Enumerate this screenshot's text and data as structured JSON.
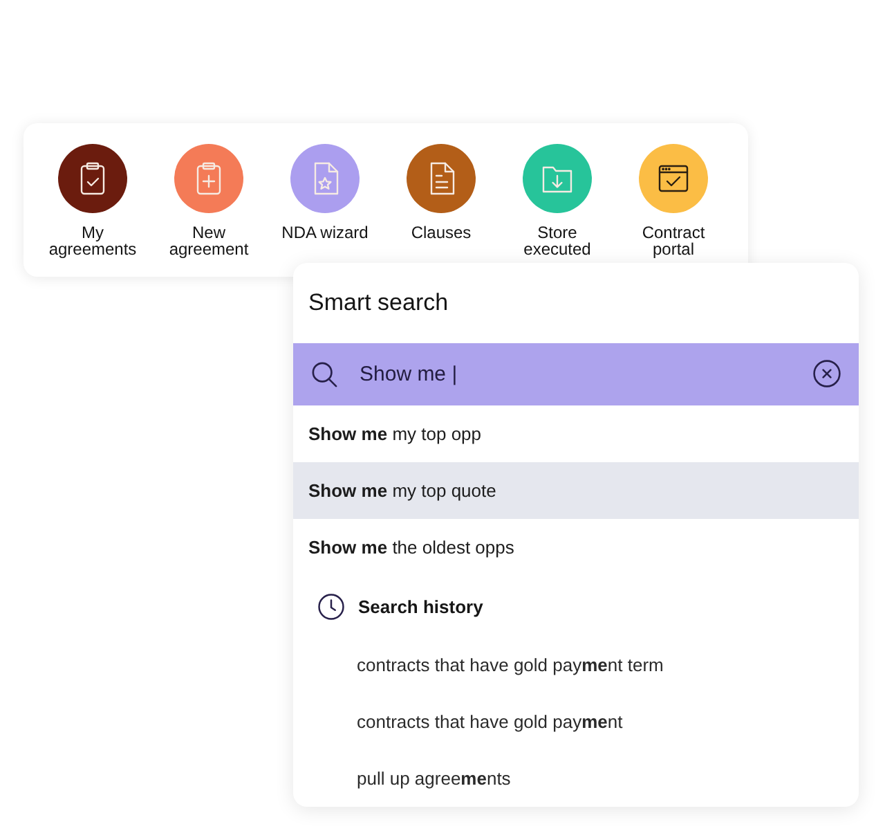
{
  "shortcuts": [
    {
      "label": "My agreements",
      "color": "#6b1c0e"
    },
    {
      "label": "New agreement",
      "color": "#f47b57"
    },
    {
      "label": "NDA wizard",
      "color": "#ab9eef"
    },
    {
      "label": "Clauses",
      "color": "#b35e18"
    },
    {
      "label": "Store executed",
      "color": "#27c49a"
    },
    {
      "label": "Contract portal",
      "color": "#fbbd45"
    }
  ],
  "smart_search": {
    "title": "Smart search",
    "search": {
      "value": "Show me |"
    },
    "suggestions": [
      {
        "text": "**Show me** my top opp",
        "selected": false
      },
      {
        "text": "**Show me** my top quote",
        "selected": true
      },
      {
        "text": "**Show me** the oldest opps",
        "selected": false
      }
    ],
    "history": {
      "title": "Search history",
      "items": [
        "contracts that have gold pay**me**nt term",
        "contracts that have gold pay**me**nt",
        "pull up agree**me**nts"
      ]
    }
  }
}
